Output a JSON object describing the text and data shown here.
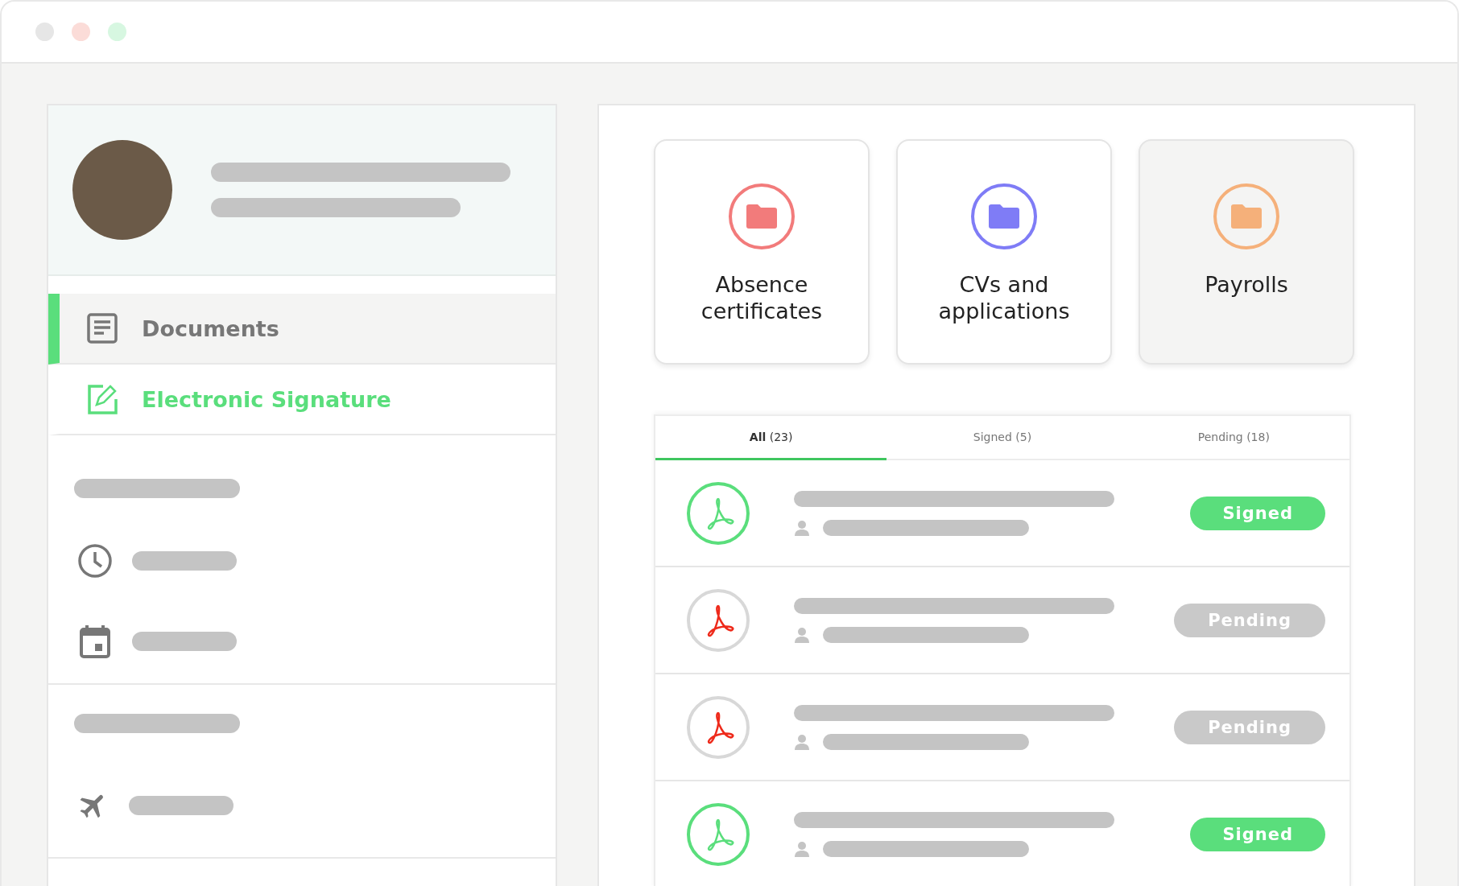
{
  "sidebar": {
    "nav": [
      {
        "label": "Documents",
        "kind": "document",
        "selected": true,
        "accent": false
      },
      {
        "label": "Electronic Signature",
        "kind": "signature",
        "selected": false,
        "accent": true
      }
    ],
    "shortcuts": [
      {
        "kind": "clock"
      },
      {
        "kind": "calendar"
      }
    ],
    "extra": [
      {
        "kind": "plane"
      }
    ]
  },
  "folders": [
    {
      "label": "Absence certificates",
      "color": "#f27b7b",
      "selected": false
    },
    {
      "label": "CVs and applications",
      "color": "#7f7cf6",
      "selected": false
    },
    {
      "label": "Payrolls",
      "color": "#f5b07a",
      "selected": true
    }
  ],
  "tabs": [
    {
      "label": "**All** (23)",
      "selected": true
    },
    {
      "label": "Signed (5)",
      "selected": false
    },
    {
      "label": "Pending (18)",
      "selected": false
    }
  ],
  "documents": [
    {
      "status": "Signed",
      "kind": "signed"
    },
    {
      "status": "Pending",
      "kind": "pending"
    },
    {
      "status": "Pending",
      "kind": "pending"
    },
    {
      "status": "Signed",
      "kind": "signed"
    }
  ]
}
